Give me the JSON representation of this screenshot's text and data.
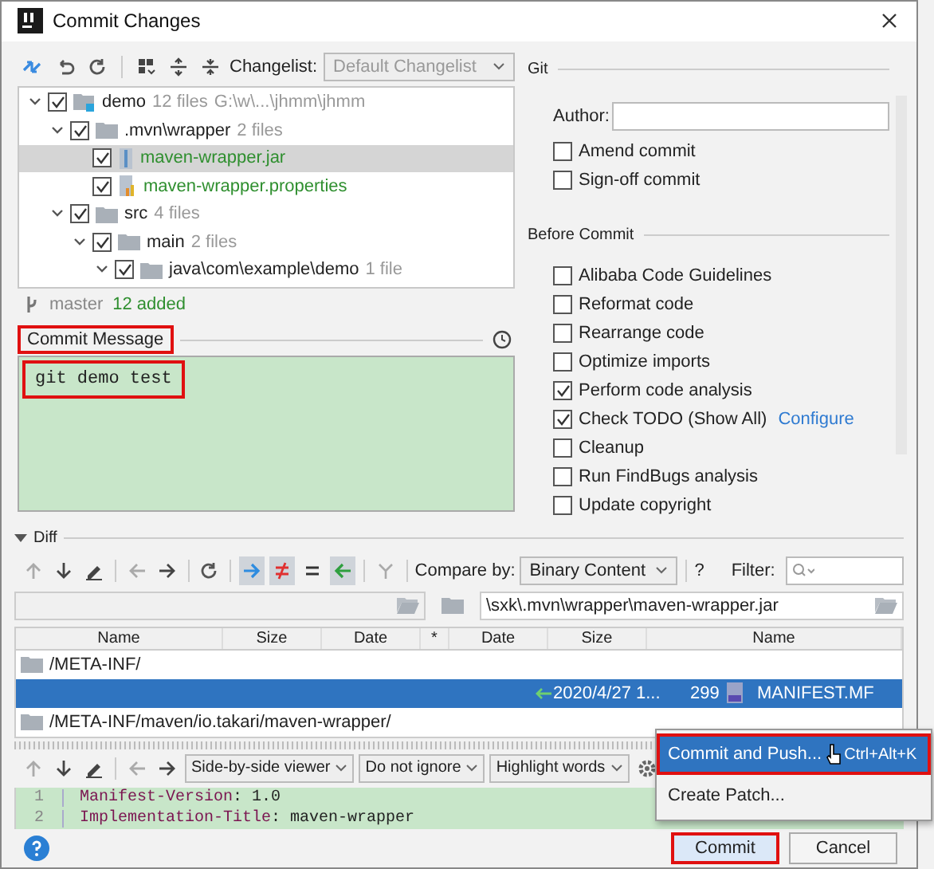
{
  "window": {
    "title": "Commit Changes"
  },
  "changes": {
    "changelist_label": "Changelist:",
    "changelist_value": "Default Changelist",
    "tree": [
      {
        "label": "demo",
        "info": "12 files",
        "path": "G:\\w\\...\\jhmm\\jhmm",
        "kind": "module",
        "checked": true,
        "expanded": true,
        "selected": false,
        "children": [
          {
            "label": ".mvn\\wrapper",
            "info": "2 files",
            "kind": "folder",
            "checked": true,
            "expanded": true,
            "selected": false,
            "children": [
              {
                "label": "maven-wrapper.jar",
                "kind": "jar",
                "checked": true,
                "selected": true
              },
              {
                "label": "maven-wrapper.properties",
                "kind": "properties",
                "checked": true,
                "selected": false
              }
            ]
          },
          {
            "label": "src",
            "info": "4 files",
            "kind": "folder",
            "checked": true,
            "expanded": true,
            "selected": false,
            "children": [
              {
                "label": "main",
                "info": "2 files",
                "kind": "folder",
                "checked": true,
                "expanded": true,
                "selected": false,
                "children": [
                  {
                    "label": "java\\com\\example\\demo",
                    "info": "1 file",
                    "kind": "folder",
                    "checked": true,
                    "expanded": true,
                    "selected": false
                  }
                ]
              }
            ]
          }
        ]
      }
    ],
    "branch": "master",
    "added": "12 added"
  },
  "commit_message": {
    "label": "Commit Message",
    "value": "git demo test",
    "highlighted": true
  },
  "git": {
    "title": "Git",
    "author_label": "Author:",
    "options": [
      {
        "label": "Amend commit",
        "checked": false
      },
      {
        "label": "Sign-off commit",
        "checked": false
      }
    ]
  },
  "before_commit": {
    "title": "Before Commit",
    "options": [
      {
        "label": "Alibaba Code Guidelines",
        "checked": false
      },
      {
        "label": "Reformat code",
        "checked": false
      },
      {
        "label": "Rearrange code",
        "checked": false
      },
      {
        "label": "Optimize imports",
        "checked": false
      },
      {
        "label": "Perform code analysis",
        "checked": true
      },
      {
        "label": "Check TODO (Show All)",
        "checked": true,
        "link": "Configure"
      },
      {
        "label": "Cleanup",
        "checked": false
      },
      {
        "label": "Run FindBugs analysis",
        "checked": false
      },
      {
        "label": "Update copyright",
        "checked": false
      }
    ]
  },
  "diff": {
    "title": "Diff",
    "expanded": true,
    "toggles": [
      {
        "kind": "arrow-right",
        "on": true
      },
      {
        "kind": "not-equal",
        "on": true
      },
      {
        "kind": "equal",
        "on": false
      },
      {
        "kind": "arrow-left",
        "on": true
      }
    ],
    "compare_label": "Compare by:",
    "compare_value": "Binary Content",
    "help": "?",
    "filter_label": "Filter:",
    "right_path": "\\sxk\\.mvn\\wrapper\\maven-wrapper.jar",
    "columns": [
      "Name",
      "Size",
      "Date",
      "*",
      "Date",
      "Size",
      "Name"
    ],
    "rows": [
      {
        "kind": "folder",
        "name": "/META-INF/",
        "selected": false
      },
      {
        "kind": "file",
        "selected": true,
        "date": "2020/4/27 1...",
        "size": "299",
        "name": "MANIFEST.MF"
      },
      {
        "kind": "folder",
        "name": "/META-INF/maven/io.takari/maven-wrapper/",
        "selected": false
      }
    ],
    "viewer": "Side-by-side viewer",
    "ignore": "Do not ignore",
    "highlight": "Highlight words",
    "lines": [
      {
        "number": "1",
        "key": "Manifest-Version",
        "value": ": 1.0"
      },
      {
        "number": "2",
        "key": "Implementation-Title",
        "value": ": maven-wrapper"
      }
    ]
  },
  "popup": {
    "items": [
      {
        "label": "Commit and Push...",
        "shortcut": "Ctrl+Alt+K",
        "selected": true,
        "highlighted": true
      },
      {
        "label": "Create Patch...",
        "selected": false,
        "highlighted": false
      }
    ]
  },
  "footer": {
    "buttons": [
      {
        "label": "Commit",
        "kind": "primary",
        "highlighted": true
      },
      {
        "label": "Cancel",
        "kind": "default",
        "highlighted": false
      }
    ]
  }
}
